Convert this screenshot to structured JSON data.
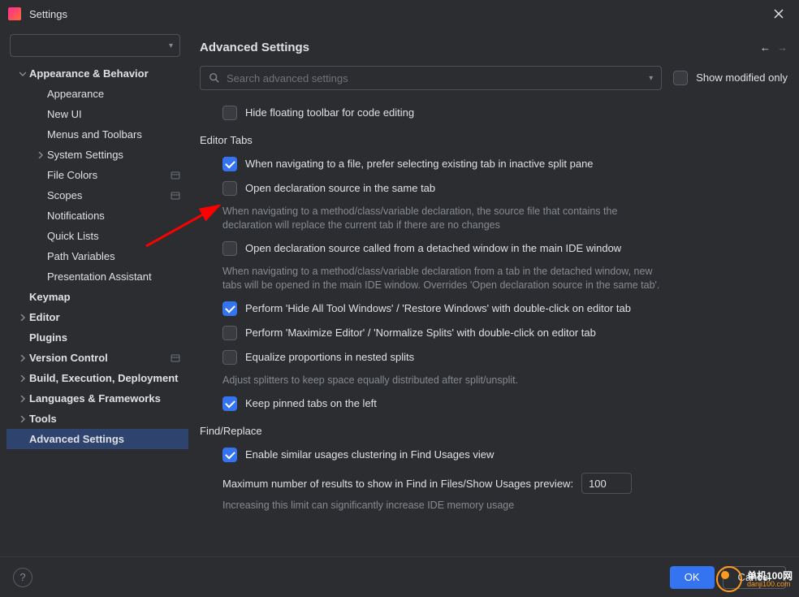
{
  "window": {
    "title": "Settings"
  },
  "sidebar": {
    "search": "",
    "items": [
      {
        "label": "Appearance & Behavior",
        "bold": true,
        "level": 0,
        "chev": "down"
      },
      {
        "label": "Appearance",
        "level": 1
      },
      {
        "label": "New UI",
        "level": 1
      },
      {
        "label": "Menus and Toolbars",
        "level": 1
      },
      {
        "label": "System Settings",
        "level": 1,
        "chev": "right"
      },
      {
        "label": "File Colors",
        "level": 1,
        "sep": true
      },
      {
        "label": "Scopes",
        "level": 1,
        "sep": true
      },
      {
        "label": "Notifications",
        "level": 1
      },
      {
        "label": "Quick Lists",
        "level": 1
      },
      {
        "label": "Path Variables",
        "level": 1
      },
      {
        "label": "Presentation Assistant",
        "level": 1
      },
      {
        "label": "Keymap",
        "bold": true,
        "level": 0
      },
      {
        "label": "Editor",
        "bold": true,
        "level": 0,
        "chev": "right"
      },
      {
        "label": "Plugins",
        "bold": true,
        "level": 0
      },
      {
        "label": "Version Control",
        "bold": true,
        "level": 0,
        "chev": "right",
        "sep": true
      },
      {
        "label": "Build, Execution, Deployment",
        "bold": true,
        "level": 0,
        "chev": "right"
      },
      {
        "label": "Languages & Frameworks",
        "bold": true,
        "level": 0,
        "chev": "right"
      },
      {
        "label": "Tools",
        "bold": true,
        "level": 0,
        "chev": "right"
      },
      {
        "label": "Advanced Settings",
        "bold": true,
        "level": 0,
        "selected": true
      }
    ]
  },
  "content": {
    "title": "Advanced Settings",
    "search_placeholder": "Search advanced settings",
    "show_modified": "Show modified only",
    "hide_floating": "Hide floating toolbar for code editing",
    "section_editor_tabs": "Editor Tabs",
    "opt1": "When navigating to a file, prefer selecting existing tab in inactive split pane",
    "opt2": "Open declaration source in the same tab",
    "opt2_desc": "When navigating to a method/class/variable declaration, the source file that contains the declaration will replace the current tab if there are no changes",
    "opt3": "Open declaration source called from a detached window in the main IDE window",
    "opt3_desc": "When navigating to a method/class/variable declaration from a tab in the detached window, new tabs will be opened in the main IDE window. Overrides 'Open declaration source in the same tab'.",
    "opt4": "Perform 'Hide All Tool Windows' / 'Restore Windows' with double-click on editor tab",
    "opt5": "Perform 'Maximize Editor' / 'Normalize Splits' with double-click on editor tab",
    "opt6": "Equalize proportions in nested splits",
    "opt6_desc": "Adjust splitters to keep space equally distributed after split/unsplit.",
    "opt7": "Keep pinned tabs on the left",
    "section_find": "Find/Replace",
    "opt8": "Enable similar usages clustering in Find Usages view",
    "max_results_label": "Maximum number of results to show in Find in Files/Show Usages preview:",
    "max_results_value": "100",
    "max_results_desc": "Increasing this limit can significantly increase IDE memory usage"
  },
  "footer": {
    "ok": "OK",
    "cancel": "Cancel"
  },
  "watermark": {
    "line1": "单机100网",
    "line2": "danji100.com"
  }
}
